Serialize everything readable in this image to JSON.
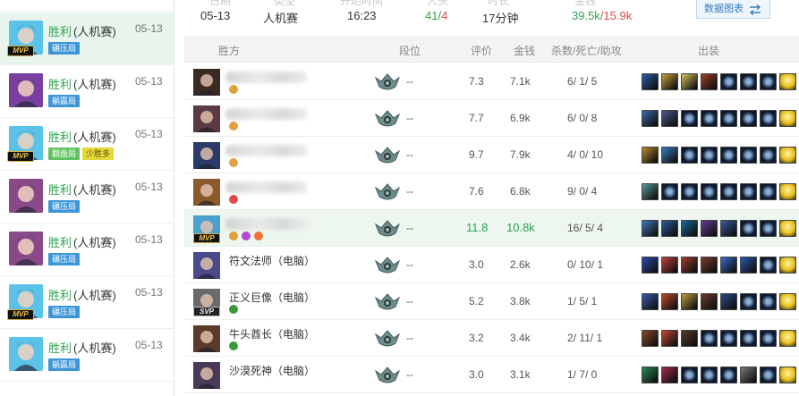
{
  "summary": {
    "labels": [
      "日期",
      "类型",
      "开始时间",
      "人头",
      "时长",
      "金钱"
    ],
    "date": "05-13",
    "type": "人机赛",
    "start_time": "16:23",
    "kills": "41",
    "kills_sep": "/",
    "deaths": "4",
    "duration": "17分钟",
    "gold_a": "39.5k",
    "gold_sep": "/",
    "gold_b": "15.9k",
    "chart_button": "数据图表",
    "chart_icon": "swap-arrows-icon"
  },
  "sidebar": {
    "items": [
      {
        "result": "胜利",
        "mode": "(人机赛)",
        "date": "05-13",
        "tags": [
          "碾压局"
        ],
        "mvp": true,
        "champion_color": "#5cc3e8"
      },
      {
        "result": "胜利",
        "mode": "(人机赛)",
        "date": "05-13",
        "tags": [
          "躺赢局"
        ],
        "mvp": false,
        "champion_color": "#7a3fa0"
      },
      {
        "result": "胜利",
        "mode": "(人机赛)",
        "date": "05-13",
        "tags": [
          "翻盘局",
          "少胜多"
        ],
        "mvp": true,
        "champion_color": "#5cc3e8"
      },
      {
        "result": "胜利",
        "mode": "(人机赛)",
        "date": "05-13",
        "tags": [
          "碾压局"
        ],
        "mvp": false,
        "champion_color": "#8a4a8a"
      },
      {
        "result": "胜利",
        "mode": "(人机赛)",
        "date": "05-13",
        "tags": [
          "碾压局"
        ],
        "mvp": false,
        "champion_color": "#8a4a8a"
      },
      {
        "result": "胜利",
        "mode": "(人机赛)",
        "date": "05-13",
        "tags": [
          "碾压局"
        ],
        "mvp": true,
        "champion_color": "#5cc3e8"
      },
      {
        "result": "胜利",
        "mode": "(人机赛)",
        "date": "05-13",
        "tags": [
          "躺赢局"
        ],
        "mvp": false,
        "champion_color": "#5cc3e8"
      }
    ]
  },
  "table": {
    "headers": {
      "team": "胜方",
      "rank": "段位",
      "score": "评价",
      "gold": "金钱",
      "kda": "杀数/死亡/助攻",
      "items": "出装"
    },
    "rows": [
      {
        "name": "",
        "rank": "--",
        "score": "7.3",
        "gold": "7.1k",
        "kda": "6/ 1/ 5",
        "badge": "",
        "avatar": "#3a2a24",
        "items": [
          "#2b5ea8",
          "#c8a040",
          "#d9c25a",
          "#a04020",
          "#1a2a4a",
          "#1a2a4a",
          "#1a2a4a",
          "#e8c020"
        ]
      },
      {
        "name": "",
        "rank": "--",
        "score": "7.7",
        "gold": "6.9k",
        "kda": "6/ 0/ 8",
        "badge": "",
        "avatar": "#5a3a44",
        "items": [
          "#3a6ab0",
          "#4a5a8a",
          "#1a2a4a",
          "#1a2a4a",
          "#1a2a4a",
          "#1a2a4a",
          "#1a2a4a",
          "#e8c020"
        ]
      },
      {
        "name": "",
        "rank": "--",
        "score": "9.7",
        "gold": "7.9k",
        "kda": "4/ 0/ 10",
        "badge": "",
        "avatar": "#2a3a6a",
        "items": [
          "#c08a30",
          "#3a7ac0",
          "#1a2a4a",
          "#1a2a4a",
          "#1a2a4a",
          "#1a2a4a",
          "#1a2a4a",
          "#e8c020"
        ]
      },
      {
        "name": "",
        "rank": "--",
        "score": "7.6",
        "gold": "6.8k",
        "kda": "9/ 0/ 4",
        "badge": "",
        "avatar": "#8a5a2a",
        "items": [
          "#5a9a9a",
          "#1a2a4a",
          "#1a2a4a",
          "#1a2a4a",
          "#1a2a4a",
          "#1a2a4a",
          "#1a2a4a",
          "#e8c020"
        ]
      },
      {
        "name": "",
        "rank": "--",
        "score": "11.8",
        "gold": "10.8k",
        "kda": "16/ 5/ 4",
        "badge": "MVP",
        "avatar": "#4aa0d0",
        "highlight": true,
        "items": [
          "#3a7ac0",
          "#2a5a9a",
          "#1a6a9a",
          "#6a3a9a",
          "#3a5aa0",
          "#1a2a4a",
          "#1a2a4a",
          "#e8c020"
        ]
      },
      {
        "name": "符文法师（电脑）",
        "rank": "--",
        "score": "3.0",
        "gold": "2.6k",
        "kda": "0/ 10/ 1",
        "badge": "",
        "avatar": "#4a4a8a",
        "items": [
          "#2a4ab0",
          "#c04040",
          "#a03a2a",
          "#7a3a2a",
          "#3a6ad0",
          "#2a5ab0",
          "#1a2a4a",
          "#e8c020"
        ]
      },
      {
        "name": "正义巨像（电脑）",
        "rank": "--",
        "score": "5.2",
        "gold": "3.8k",
        "kda": "1/ 5/ 1",
        "badge": "SVP",
        "avatar": "#6a6a6a",
        "items": [
          "#3a5ab0",
          "#c04a2a",
          "#c0a040",
          "#6a3a2a",
          "#2a4a8a",
          "#1a2a4a",
          "#1a2a4a",
          "#e8c020"
        ]
      },
      {
        "name": "牛头酋长（电脑）",
        "rank": "--",
        "score": "3.2",
        "gold": "3.4k",
        "kda": "2/ 11/ 1",
        "badge": "",
        "avatar": "#5a3a2a",
        "items": [
          "#8a4a2a",
          "#c04a3a",
          "#5a3a2a",
          "#1a2a4a",
          "#1a2a4a",
          "#1a2a4a",
          "#1a2a4a",
          "#e8c020"
        ]
      },
      {
        "name": "沙漠死神（电脑）",
        "rank": "--",
        "score": "3.0",
        "gold": "3.1k",
        "kda": "1/ 7/ 0",
        "badge": "",
        "avatar": "#4a3a5a",
        "items": [
          "#2a8a5a",
          "#a02a4a",
          "#1a2a4a",
          "#1a2a4a",
          "#1a2a4a",
          "#7a7a7a",
          "#1a2a4a",
          "#e8c020"
        ]
      }
    ]
  },
  "colors": {
    "accent_green": "#2da54d",
    "death_red": "#e24a4a",
    "tag_blue": "#3d96d8",
    "tag_green": "#62c262",
    "tag_yellow": "#e6d83c",
    "mvp_row_bg": "#edf6ef",
    "active_item_bg": "#e8f4ec"
  }
}
